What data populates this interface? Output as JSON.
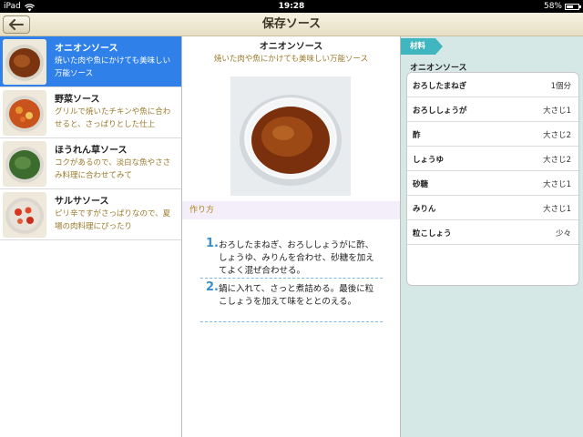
{
  "status_bar": {
    "carrier": "iPad",
    "time": "19:28",
    "battery": "58%",
    "battery_level": 0.58
  },
  "nav": {
    "title": "保存ソース",
    "back_icon": "back-arrow-icon"
  },
  "recipes": [
    {
      "name": "オニオンソース",
      "desc": "焼いた肉や魚にかけても美味しい万能ソース",
      "selected": true
    },
    {
      "name": "野菜ソース",
      "desc": "グリルで焼いたチキンや魚に合わせると、さっぱりとした仕上",
      "selected": false
    },
    {
      "name": "ほうれん草ソース",
      "desc": "コクがあるので、淡白な魚やささみ料理に合わせてみて",
      "selected": false
    },
    {
      "name": "サルサソース",
      "desc": "ピリ辛ですがさっぱりなので、夏場の肉料理にぴったり",
      "selected": false
    }
  ],
  "detail": {
    "title": "オニオンソース",
    "subtitle": "焼いた肉や魚にかけても美味しい万能ソース",
    "howto_label": "作り方",
    "steps": [
      {
        "num": "1.",
        "text": "おろしたまねぎ、おろししょうがに酢、しょうゆ、みりんを合わせ、砂糖を加えてよく混ぜ合わせる。"
      },
      {
        "num": "2.",
        "text": "鍋に入れて、さっと煮詰める。最後に粒こしょうを加えて味をととのえる。"
      }
    ]
  },
  "ingredients": {
    "tag": "材料",
    "heading": "オニオンソース",
    "items": [
      {
        "name": "おろしたまねぎ",
        "qty": "1個分"
      },
      {
        "name": "おろししょうが",
        "qty": "大さじ1"
      },
      {
        "name": "酢",
        "qty": "大さじ2"
      },
      {
        "name": "しょうゆ",
        "qty": "大さじ2"
      },
      {
        "name": "砂糖",
        "qty": "大さじ1"
      },
      {
        "name": "みりん",
        "qty": "大さじ1"
      },
      {
        "name": "粒こしょう",
        "qty": "少々"
      }
    ]
  },
  "colors": {
    "selected_row": "#2f80e9",
    "description_text": "#9a7a2c",
    "step_number": "#3b8fd0",
    "ingredient_tag": "#3fb6c0",
    "right_panel_bg": "#d6e8e6"
  }
}
